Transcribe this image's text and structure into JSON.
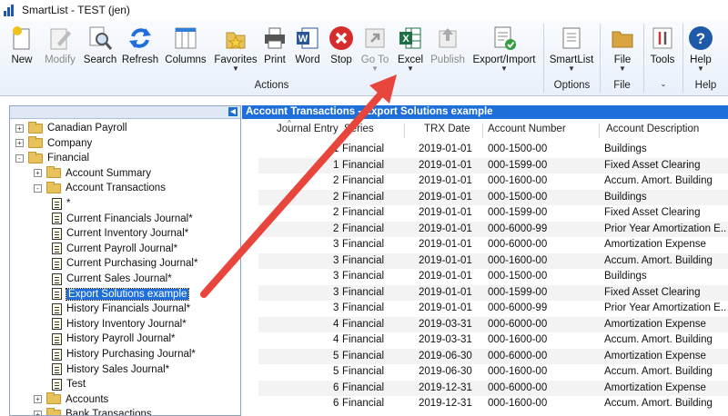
{
  "window": {
    "title": "SmartList - TEST (jen)"
  },
  "toolbar": {
    "buttons": [
      {
        "label": "New",
        "icon": "new-document-icon"
      },
      {
        "label": "Modify",
        "icon": "modify-icon"
      },
      {
        "label": "Search",
        "icon": "search-icon"
      },
      {
        "label": "Refresh",
        "icon": "refresh-icon"
      },
      {
        "label": "Columns",
        "icon": "columns-icon"
      },
      {
        "label": "Favorites",
        "icon": "favorites-icon"
      },
      {
        "label": "Print",
        "icon": "printer-icon"
      },
      {
        "label": "Word",
        "icon": "word-icon"
      },
      {
        "label": "Stop",
        "icon": "stop-icon"
      },
      {
        "label": "Go To",
        "icon": "goto-icon"
      },
      {
        "label": "Excel",
        "icon": "excel-icon"
      },
      {
        "label": "Publish",
        "icon": "publish-icon"
      },
      {
        "label": "Export/Import",
        "icon": "export-import-icon"
      },
      {
        "label": "SmartList",
        "icon": "smartlist-icon"
      },
      {
        "label": "File",
        "icon": "folder-icon"
      },
      {
        "label": "Tools",
        "icon": "tools-icon"
      },
      {
        "label": "Help",
        "icon": "help-icon"
      }
    ],
    "groups": [
      "Actions",
      "Options",
      "File",
      "Help"
    ]
  },
  "tree": [
    {
      "label": "Canadian Payroll",
      "kind": "folder",
      "exp": "+"
    },
    {
      "label": "Company",
      "kind": "folder",
      "exp": "+"
    },
    {
      "label": "Financial",
      "kind": "folder",
      "exp": "-"
    },
    {
      "label": "Account Summary",
      "kind": "folder",
      "exp": "+"
    },
    {
      "label": "Account Transactions",
      "kind": "folder",
      "exp": "-"
    },
    {
      "label": "*",
      "kind": "doc"
    },
    {
      "label": "Current Financials Journal*",
      "kind": "doc"
    },
    {
      "label": "Current Inventory Journal*",
      "kind": "doc"
    },
    {
      "label": "Current Payroll Journal*",
      "kind": "doc"
    },
    {
      "label": "Current Purchasing Journal*",
      "kind": "doc"
    },
    {
      "label": "Current Sales Journal*",
      "kind": "doc"
    },
    {
      "label": "Export Solutions example",
      "kind": "doc",
      "selected": true
    },
    {
      "label": "History Financials Journal*",
      "kind": "doc"
    },
    {
      "label": "History Inventory Journal*",
      "kind": "doc"
    },
    {
      "label": "History Payroll Journal*",
      "kind": "doc"
    },
    {
      "label": "History Purchasing Journal*",
      "kind": "doc"
    },
    {
      "label": "History Sales Journal*",
      "kind": "doc"
    },
    {
      "label": "Test",
      "kind": "doc"
    },
    {
      "label": "Accounts",
      "kind": "folder",
      "exp": "+"
    },
    {
      "label": "Bank Transactions",
      "kind": "folder",
      "exp": "+"
    }
  ],
  "results": {
    "title": "Account Transactions - Export Solutions example",
    "columns": [
      "Journal Entry",
      "Series",
      "TRX Date",
      "Account Number",
      "Account Description"
    ],
    "rows": [
      [
        "1",
        "Financial",
        "2019-01-01",
        "000-1500-00",
        "Buildings"
      ],
      [
        "1",
        "Financial",
        "2019-01-01",
        "000-1599-00",
        "Fixed Asset Clearing"
      ],
      [
        "2",
        "Financial",
        "2019-01-01",
        "000-1600-00",
        "Accum. Amort. Building"
      ],
      [
        "2",
        "Financial",
        "2019-01-01",
        "000-1500-00",
        "Buildings"
      ],
      [
        "2",
        "Financial",
        "2019-01-01",
        "000-1599-00",
        "Fixed Asset Clearing"
      ],
      [
        "2",
        "Financial",
        "2019-01-01",
        "000-6000-99",
        "Prior Year Amortization E..."
      ],
      [
        "3",
        "Financial",
        "2019-01-01",
        "000-6000-00",
        "Amortization Expense"
      ],
      [
        "3",
        "Financial",
        "2019-01-01",
        "000-1600-00",
        "Accum. Amort. Building"
      ],
      [
        "3",
        "Financial",
        "2019-01-01",
        "000-1500-00",
        "Buildings"
      ],
      [
        "3",
        "Financial",
        "2019-01-01",
        "000-1599-00",
        "Fixed Asset Clearing"
      ],
      [
        "3",
        "Financial",
        "2019-01-01",
        "000-6000-99",
        "Prior Year Amortization E..."
      ],
      [
        "4",
        "Financial",
        "2019-03-31",
        "000-6000-00",
        "Amortization Expense"
      ],
      [
        "4",
        "Financial",
        "2019-03-31",
        "000-1600-00",
        "Accum. Amort. Building"
      ],
      [
        "5",
        "Financial",
        "2019-06-30",
        "000-6000-00",
        "Amortization Expense"
      ],
      [
        "5",
        "Financial",
        "2019-06-30",
        "000-1600-00",
        "Accum. Amort. Building"
      ],
      [
        "6",
        "Financial",
        "2019-12-31",
        "000-6000-00",
        "Amortization Expense"
      ],
      [
        "6",
        "Financial",
        "2019-12-31",
        "000-1600-00",
        "Accum. Amort. Building"
      ]
    ]
  }
}
